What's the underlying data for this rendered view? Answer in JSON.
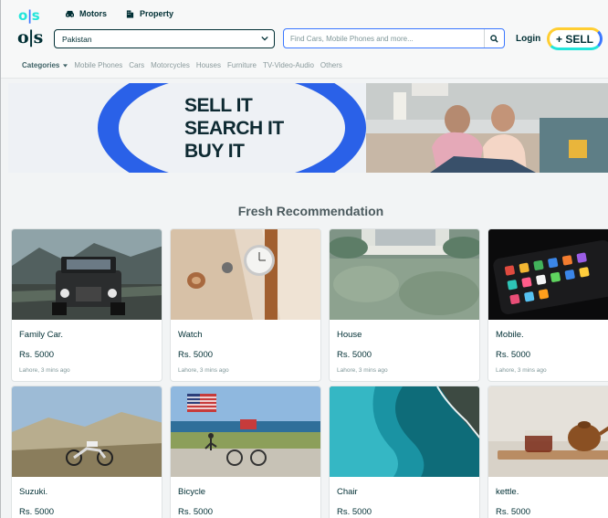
{
  "header": {
    "logo": "ols",
    "verticals": [
      {
        "label": "Motors",
        "icon": "car-icon"
      },
      {
        "label": "Property",
        "icon": "building-icon"
      }
    ],
    "location": "Pakistan",
    "search_placeholder": "Find Cars, Mobile Phones and more...",
    "login_label": "Login",
    "sell_label": "+ SELL"
  },
  "categories": {
    "label": "Categories",
    "items": [
      "Mobile Phones",
      "Cars",
      "Motorcycles",
      "Houses",
      "Furniture",
      "TV-Video-Audio",
      "Others"
    ]
  },
  "banner": {
    "lines": [
      "SELL IT",
      "SEARCH IT",
      "BUY IT"
    ]
  },
  "section_title": "Fresh Recommendation",
  "listings": [
    {
      "title": "Family Car.",
      "price": "Rs. 5000",
      "meta": "Lahore, 3 mins ago"
    },
    {
      "title": "Watch",
      "price": "Rs. 5000",
      "meta": "Lahore, 3 mins ago"
    },
    {
      "title": "House",
      "price": "Rs. 5000",
      "meta": "Lahore, 3 mins ago"
    },
    {
      "title": "Mobile.",
      "price": "Rs. 5000",
      "meta": "Lahore, 3 mins ago"
    },
    {
      "title": "Suzuki.",
      "price": "Rs. 5000",
      "meta": ""
    },
    {
      "title": "Bicycle",
      "price": "Rs. 5000",
      "meta": ""
    },
    {
      "title": "Chair",
      "price": "Rs. 5000",
      "meta": ""
    },
    {
      "title": "kettle.",
      "price": "Rs. 5000",
      "meta": ""
    }
  ],
  "colors": {
    "brand_dark": "#002f34",
    "accent_blue": "#3a77ff",
    "accent_teal": "#23e5db",
    "accent_yellow": "#ffce32"
  }
}
